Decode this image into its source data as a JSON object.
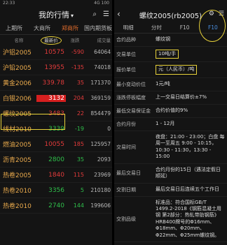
{
  "left": {
    "status_time": "22:33",
    "status_right": "4G 100",
    "title": "我的行情",
    "title_caret": "▾",
    "tabs": [
      {
        "label": "上期所",
        "active": false
      },
      {
        "label": "大商所",
        "active": false
      },
      {
        "label": "郑商所",
        "active": true
      },
      {
        "label": "国内期货板",
        "active": false
      }
    ],
    "columns": {
      "name": "名称",
      "price": "最新价",
      "change": "涨跌",
      "volume": "成交量"
    },
    "rows": [
      {
        "name": "沪铝2005",
        "price": "10575",
        "chg": "-590",
        "vol": "64064",
        "dir": "up"
      },
      {
        "name": "沪铅2005",
        "price": "13955",
        "chg": "-135",
        "vol": "74018",
        "dir": "up"
      },
      {
        "name": "黄金2006",
        "price": "339.78",
        "chg": "35",
        "vol": "171370",
        "dir": "up"
      },
      {
        "name": "白银2006",
        "price": "3132",
        "chg": "204",
        "vol": "369159",
        "dir": "up"
      },
      {
        "name": "螺纹2005",
        "price": "3483",
        "chg": "22",
        "vol": "854479",
        "dir": "up"
      },
      {
        "name": "线材2010",
        "price": "3339",
        "chg": "-19",
        "vol": "0",
        "dir": "down"
      },
      {
        "name": "燃油2005",
        "price": "10055",
        "chg": "185",
        "vol": "125957",
        "dir": "up"
      },
      {
        "name": "沥青2005",
        "price": "2800",
        "chg": "35",
        "vol": "2093",
        "dir": "down"
      },
      {
        "name": "热卷2005",
        "price": "1840",
        "chg": "115",
        "vol": "23969",
        "dir": "up"
      },
      {
        "name": "热卷2010",
        "price": "3356",
        "chg": "5",
        "vol": "210180",
        "dir": "down"
      },
      {
        "name": "热卷2010",
        "price": "2740",
        "chg": "144",
        "vol": "199606",
        "dir": "down"
      }
    ]
  },
  "right": {
    "title": "螺纹2005(rb2005)",
    "tabs": [
      {
        "label": "明细",
        "active": false
      },
      {
        "label": "分时",
        "active": false
      },
      {
        "label": "F10",
        "active": false
      },
      {
        "label": "F10",
        "active": true
      }
    ],
    "properties": [
      {
        "key": "合约品种",
        "value": "螺纹钢",
        "boxed": false
      },
      {
        "key": "交易单位",
        "value": "10吨/手",
        "boxed": true
      },
      {
        "key": "报价单位",
        "value": "元（人民币）/吨",
        "boxed": true
      },
      {
        "key": "最小变动价位",
        "value": "1元/吨",
        "boxed": false
      },
      {
        "key": "涨跌停板幅度",
        "value": "上一交易日结算价±7%",
        "boxed": false
      },
      {
        "key": "最低交易保证金",
        "value": "合约价值的9%",
        "boxed": false
      },
      {
        "key": "合约月份",
        "value": "1 - 12月",
        "boxed": false
      },
      {
        "key": "交易时间",
        "value": "夜盘：21:00 - 23:00；白盘 每周一至周五 9:00 - 10:15，10:30 - 11:30，13:30 - 15:00",
        "boxed": false
      },
      {
        "key": "最后交易日",
        "value": "合约月份的15日（遇法定假日顺延）",
        "boxed": false
      },
      {
        "key": "交割日期",
        "value": "最后交易日后连续五个工作日",
        "boxed": false
      },
      {
        "key": "交割品级",
        "value": "标准品：符合国标GB/T 1499.2-2018《钢筋混凝土用钢 第2部分：热轧带肋钢筋》HRB400牌号的Φ16mm、Φ18mm、Φ20mm、Φ22mm、Φ25mm螺纹钢。",
        "boxed": false
      }
    ]
  }
}
